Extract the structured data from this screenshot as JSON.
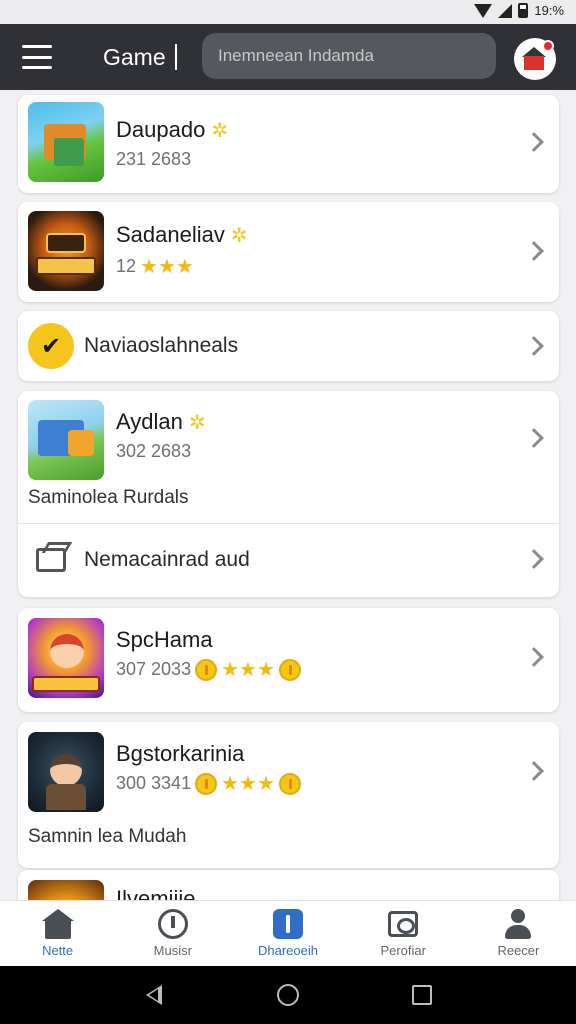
{
  "status_bar": {
    "time": "19:%"
  },
  "app_bar": {
    "title": "Game",
    "search_placeholder": "Inemneean Indamda"
  },
  "items": [
    {
      "name": "Daupado",
      "meta": "231 2683"
    },
    {
      "name": "Sadaneliav",
      "meta": "12"
    },
    {
      "label": "Naviaoslahneals"
    },
    {
      "name": "Aydlan",
      "meta": "302 2683",
      "subtext": "Saminolea Rurdals"
    },
    {
      "label": "Nemacainrad aud"
    },
    {
      "name": "SpcHama",
      "meta": "307 2033",
      "rating_stars": 3
    },
    {
      "name": "Bgstorkarinia",
      "meta": "300 3341",
      "rating_stars": 3,
      "subtext": "Samnin lea Mudah"
    },
    {
      "name": "Ilvemijie"
    }
  ],
  "bottom_nav": {
    "tabs": [
      {
        "label": "Nette",
        "icon": "home-icon"
      },
      {
        "label": "Musisr",
        "icon": "music-icon"
      },
      {
        "label": "Dhareoeih",
        "icon": "info-icon",
        "active": true
      },
      {
        "label": "Perofiar",
        "icon": "profile-icon"
      },
      {
        "label": "Reecer",
        "icon": "person-icon"
      }
    ]
  },
  "colors": {
    "app_bar": "#2f3136",
    "accent": "#2f6fc7",
    "star": "#f5b90f",
    "nav_icon_yellow": "#f6c51b"
  }
}
